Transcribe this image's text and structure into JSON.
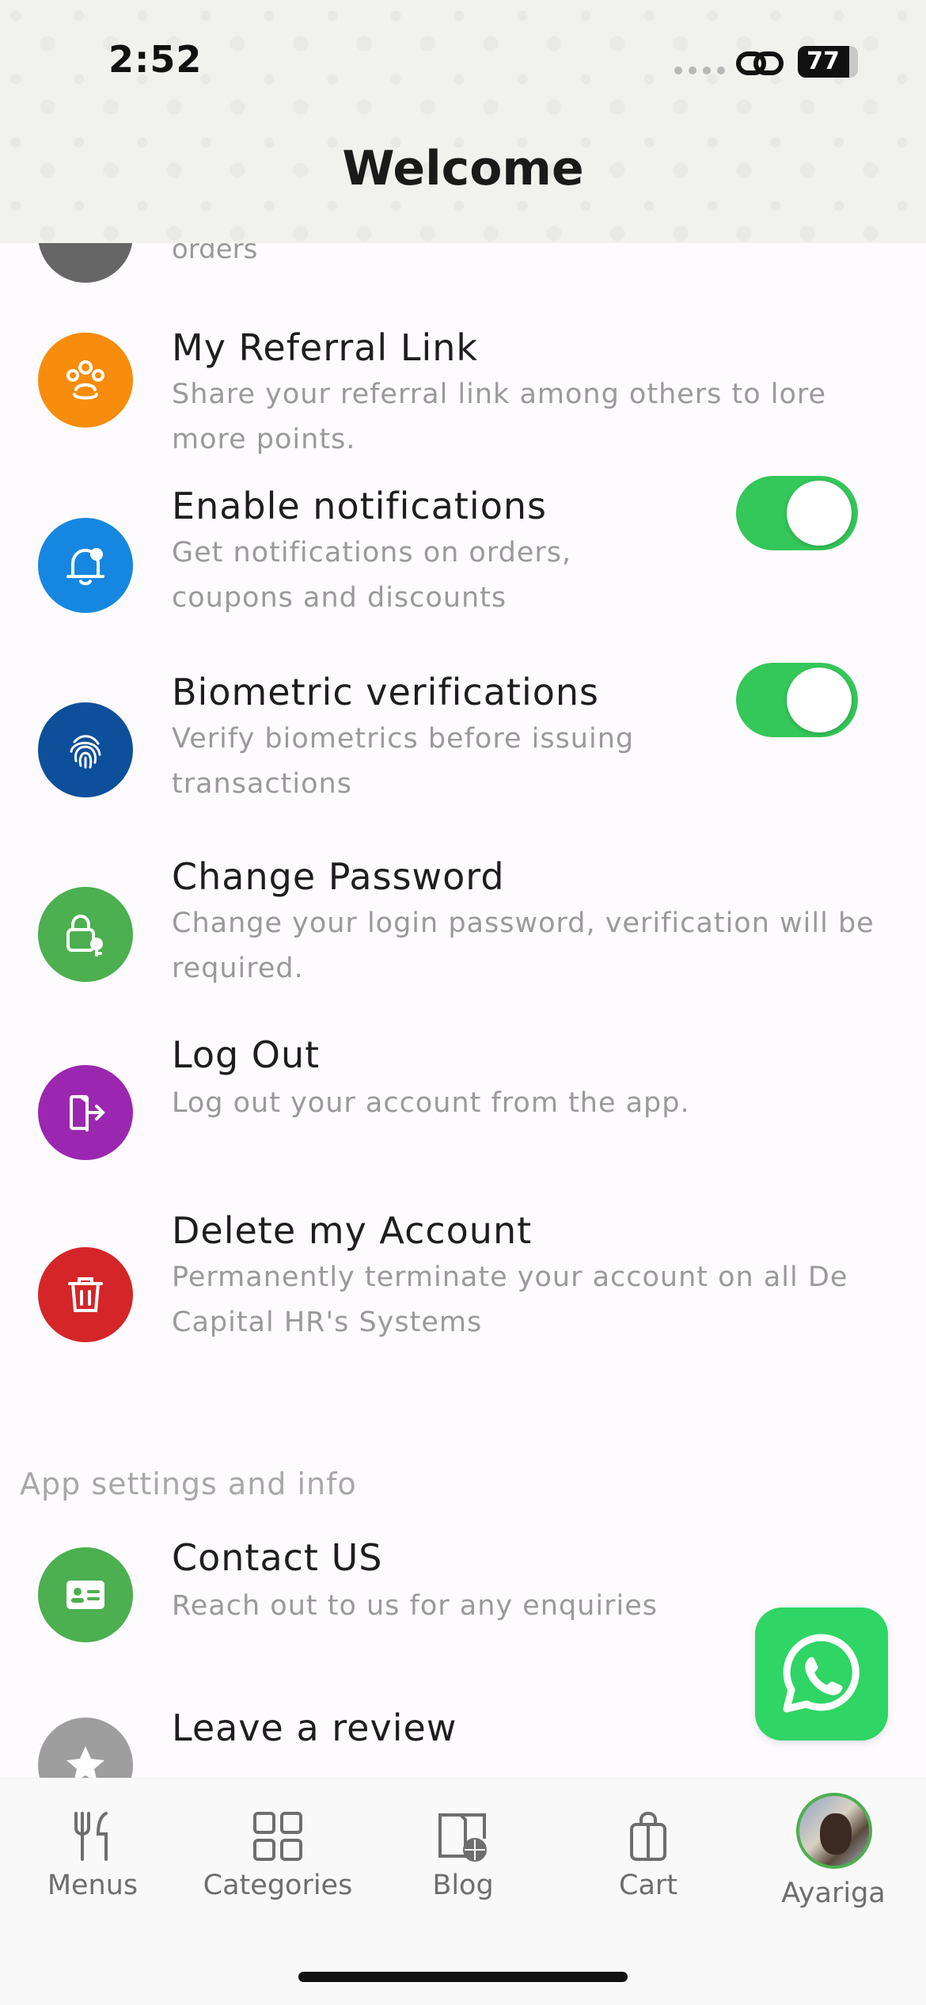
{
  "status_bar": {
    "time": "2:52",
    "battery": "77",
    "battery_level": 0.77
  },
  "header": {
    "title": "Welcome"
  },
  "cut_row": {
    "subtitle_tail": "orders"
  },
  "rows": [
    {
      "title": "My Referral Link",
      "subtitle": "Share your referral link among others to lore more points.",
      "icon": "users-icon",
      "color": "#f88c0c"
    },
    {
      "title": "Enable notifications",
      "subtitle": "Get notifications on orders, coupons and discounts",
      "icon": "bell-icon",
      "color": "#1687e0",
      "toggle": true
    },
    {
      "title": "Biometric verifications",
      "subtitle": "Verify biometrics before issuing transactions",
      "icon": "fingerprint-icon",
      "color": "#0d4f9b",
      "toggle": true
    },
    {
      "title": "Change Password",
      "subtitle": "Change your login password, verification will be required.",
      "icon": "lock-key-icon",
      "color": "#4caf50"
    },
    {
      "title": "Log Out",
      "subtitle": "Log out your account from the app.",
      "icon": "logout-icon",
      "color": "#9b27b0"
    },
    {
      "title": "Delete my Account",
      "subtitle": "Permanently terminate your account on all De Capital HR's Systems",
      "icon": "trash-icon",
      "color": "#d42628"
    }
  ],
  "section_label": "App settings and info",
  "info_rows": [
    {
      "title": "Contact US",
      "subtitle": "Reach out to us for any enquiries",
      "icon": "contact-card-icon",
      "color": "#4caf50"
    },
    {
      "title": "Leave a review",
      "subtitle": "",
      "icon": "star-icon",
      "color": "#9e9e9e"
    }
  ],
  "tabbar": {
    "items": [
      {
        "label": "Menus",
        "icon": "fork-knife-icon"
      },
      {
        "label": "Categories",
        "icon": "grid-icon"
      },
      {
        "label": "Blog",
        "icon": "book-globe-icon"
      },
      {
        "label": "Cart",
        "icon": "shopping-bag-icon"
      },
      {
        "label": "Ayariga",
        "icon": "avatar"
      }
    ]
  },
  "colors": {
    "toggle_on": "#34c759",
    "whatsapp": "#2fd565",
    "avatar_ring": "#4caf50"
  }
}
